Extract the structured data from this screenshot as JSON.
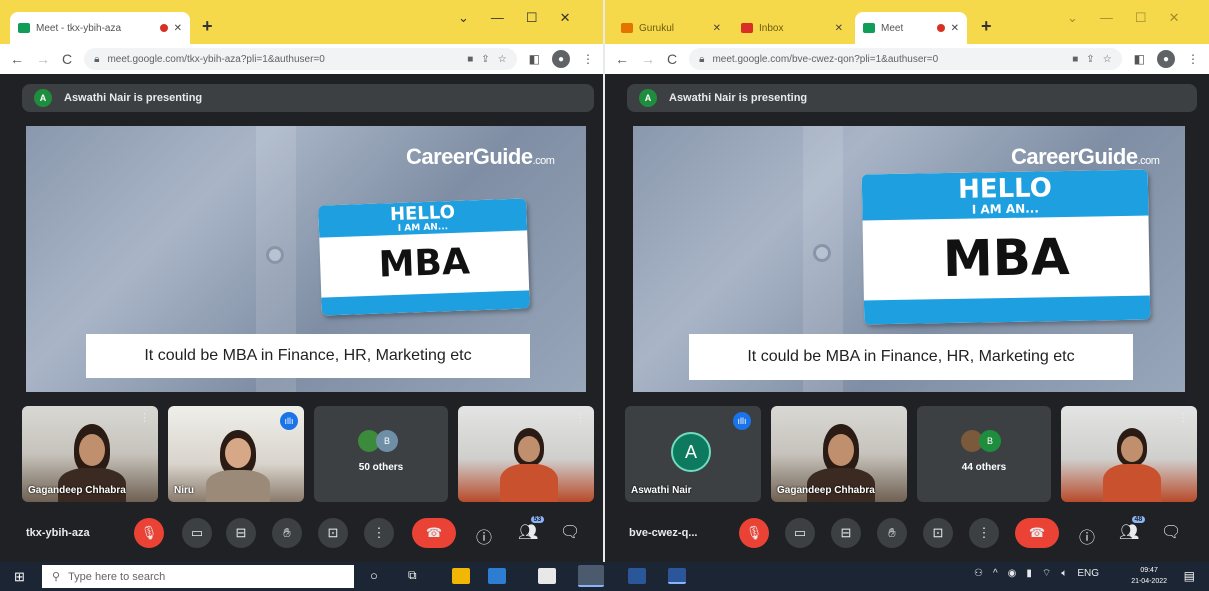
{
  "left": {
    "tabs": [
      {
        "label": "Meet - tkx-ybih-aza"
      }
    ],
    "url": "meet.google.com/tkx-ybih-aza?pli=1&authuser=0",
    "presenting": "Aswathi Nair is presenting",
    "avatar_letter": "A",
    "slide": {
      "logo": "CareerGuide",
      "logo_suffix": ".com",
      "hello": "HELLO",
      "iam": "I AM AN...",
      "mba": "MBA",
      "caption": "It could be MBA in Finance, HR, Marketing etc"
    },
    "tiles": [
      {
        "name": "Gagandeep Chhabra"
      },
      {
        "name": "Niru"
      },
      {
        "others": "50 others",
        "mini": "B"
      },
      {
        "name": ""
      }
    ],
    "meeting_code": "tkx-ybih-aza",
    "people_count": "53"
  },
  "right": {
    "tabs": [
      {
        "label": "Gurukul"
      },
      {
        "label": "Inbox"
      },
      {
        "label": "Meet"
      }
    ],
    "url": "meet.google.com/bve-cwez-qon?pli=1&authuser=0",
    "presenting": "Aswathi Nair is presenting",
    "avatar_letter": "A",
    "slide": {
      "logo": "CareerGuide",
      "logo_suffix": ".com",
      "hello": "HELLO",
      "iam": "I AM AN...",
      "mba": "MBA",
      "caption": "It could be MBA in Finance, HR, Marketing etc"
    },
    "tiles": [
      {
        "name": "Aswathi Nair",
        "letter": "A"
      },
      {
        "name": "Gagandeep Chhabra"
      },
      {
        "others": "44 others",
        "mini": "B"
      },
      {
        "name": ""
      }
    ],
    "meeting_code": "bve-cwez-q...",
    "people_count": "48"
  },
  "taskbar": {
    "search_placeholder": "Type here to search",
    "lang": "ENG",
    "time": "09:47",
    "date": "21-04-2022"
  },
  "colors": {
    "accent": "#1a73e8",
    "end_call": "#ea4335",
    "tab_bar": "#f6d94a"
  }
}
